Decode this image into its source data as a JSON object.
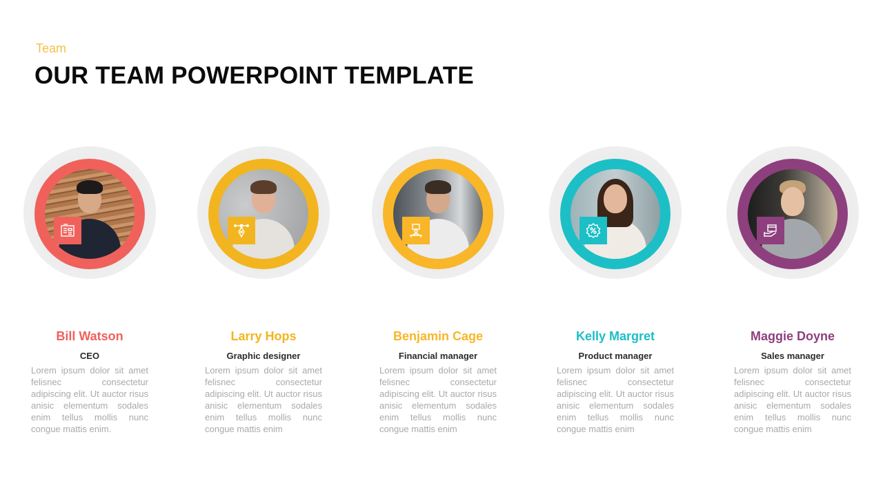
{
  "header": {
    "eyebrow": "Team",
    "title": "OUR TEAM POWERPOINT TEMPLATE"
  },
  "members": [
    {
      "name": "Bill Watson",
      "role": "CEO",
      "description": "Lorem ipsum dolor sit amet felisnec consectetur adipiscing elit. Ut auctor risus anisic elementum sodales enim tellus mollis nunc congue mattis enim.",
      "accent_color": "#f0615c",
      "icon": "newspaper-icon"
    },
    {
      "name": "Larry Hops",
      "role": "Graphic designer",
      "description": "Lorem ipsum dolor sit amet felisnec consectetur adipiscing elit. Ut auctor risus anisic elementum sodales enim tellus mollis nunc congue mattis enim",
      "accent_color": "#f2b51f",
      "icon": "pen-tool-icon"
    },
    {
      "name": "Benjamin Cage",
      "role": "Financial manager",
      "description": "Lorem ipsum dolor sit amet felisnec consectetur adipiscing elit. Ut auctor risus anisic elementum sodales enim tellus mollis nunc congue mattis enim",
      "accent_color": "#f8b628",
      "icon": "desk-worker-icon"
    },
    {
      "name": "Kelly Margret",
      "role": "Product manager",
      "description": "Lorem ipsum dolor sit amet felisnec consectetur adipiscing elit. Ut auctor risus anisic elementum sodales enim tellus mollis nunc congue mattis enim",
      "accent_color": "#1cbfc6",
      "icon": "percent-badge-icon"
    },
    {
      "name": "Maggie Doyne",
      "role": "Sales manager",
      "description": "Lorem ipsum dolor sit amet felisnec consectetur adipiscing elit. Ut auctor risus anisic elementum sodales enim tellus mollis nunc congue mattis enim",
      "accent_color": "#8e3f7e",
      "icon": "hand-box-icon"
    }
  ]
}
